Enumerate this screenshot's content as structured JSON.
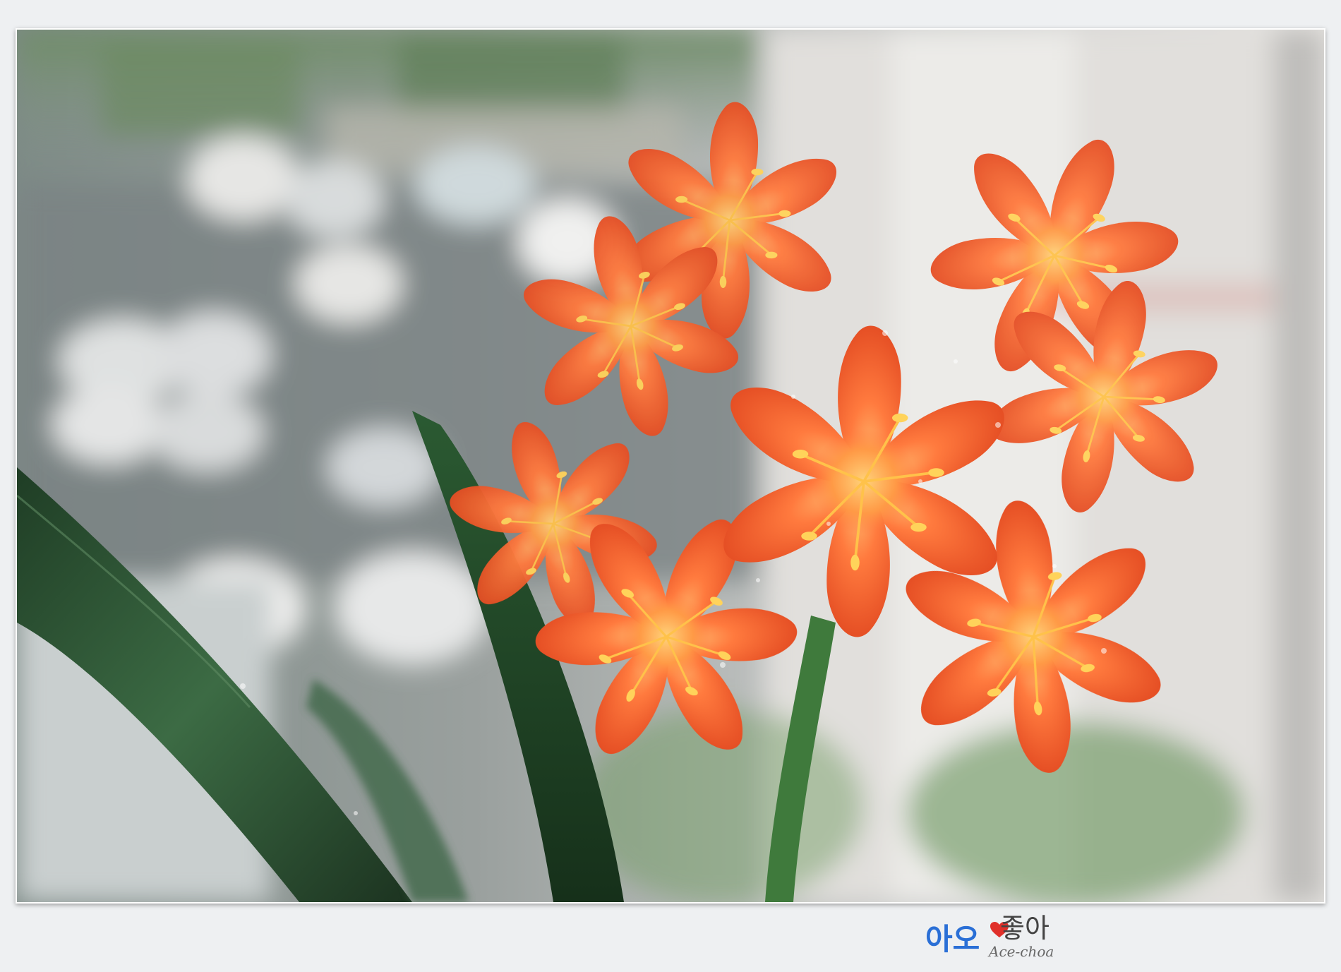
{
  "watermark": {
    "part_a": "아오",
    "part_b": "좋아",
    "script": "Ace-choa"
  },
  "colors": {
    "frame_background": "#eef0f2",
    "petal_orange": "#f0562a",
    "petal_light": "#ff8a4c",
    "leaf_green": "#2f5a37",
    "watermark_blue": "#2a6fd6",
    "heart_red": "#e0302a"
  }
}
